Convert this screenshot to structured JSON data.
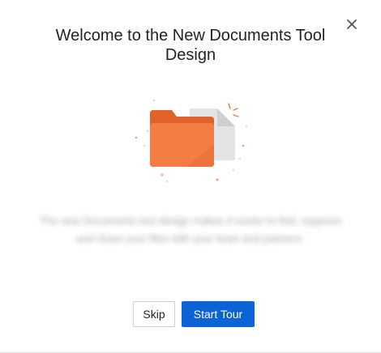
{
  "dialog": {
    "title": "Welcome to the New Documents Tool Design",
    "body_text": "The new Documents tool design makes it easier to find, organize and share your files with your team and partners.",
    "close_icon": "close-icon",
    "illustration_icon": "folder-with-document-icon",
    "skip_label": "Skip",
    "start_tour_label": "Start Tour"
  },
  "colors": {
    "accent": "#0b63d6",
    "folder_orange": "#f07a45",
    "folder_orange_dark": "#e0622b",
    "document_grey": "#e2e2e2"
  }
}
